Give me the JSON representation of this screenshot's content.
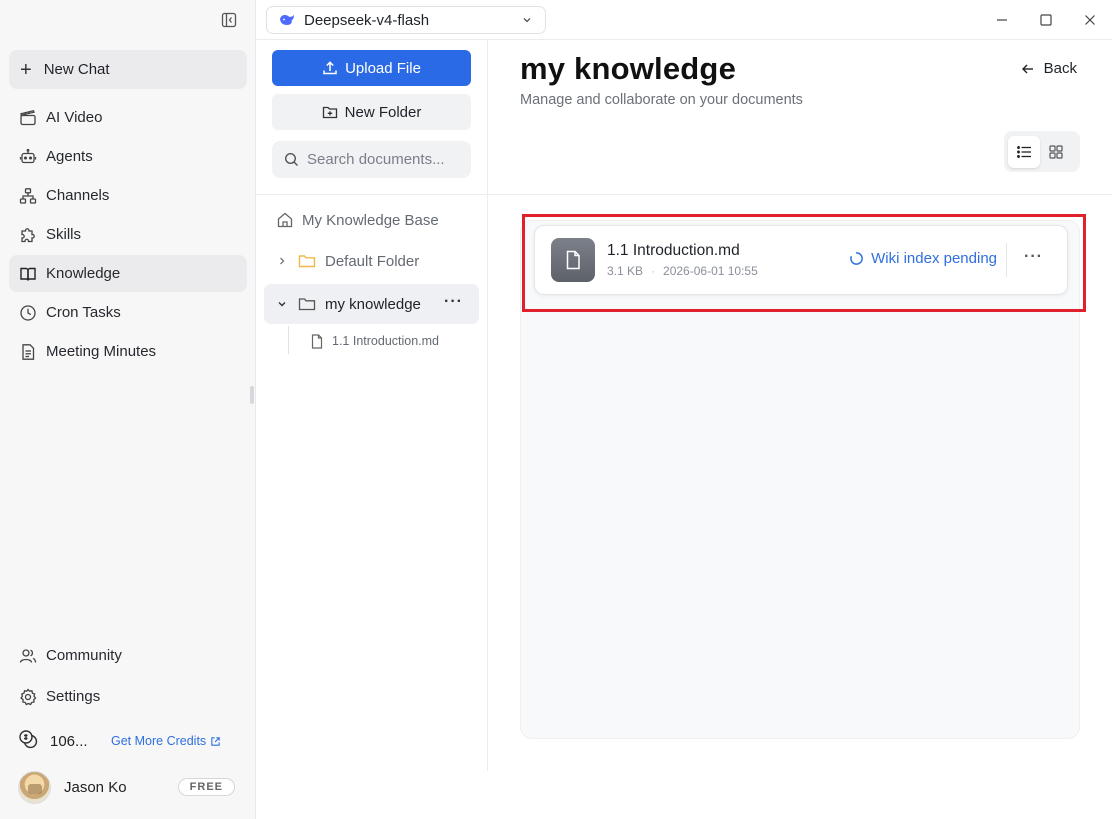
{
  "sidebar": {
    "new_chat": "New Chat",
    "items": [
      {
        "label": "AI Video",
        "icon": "clapperboard-icon"
      },
      {
        "label": "Agents",
        "icon": "robot-icon"
      },
      {
        "label": "Channels",
        "icon": "network-icon"
      },
      {
        "label": "Skills",
        "icon": "puzzle-icon"
      },
      {
        "label": "Knowledge",
        "icon": "book-icon",
        "active": true
      },
      {
        "label": "Cron Tasks",
        "icon": "clock-icon"
      },
      {
        "label": "Meeting Minutes",
        "icon": "document-icon"
      }
    ],
    "bottom_items": [
      {
        "label": "Community",
        "icon": "users-icon"
      },
      {
        "label": "Settings",
        "icon": "gear-icon"
      }
    ],
    "credits": "106...",
    "get_more_credits": "Get More Credits",
    "user_name": "Jason Ko",
    "plan_badge": "FREE"
  },
  "topbar": {
    "model": "Deepseek-v4-flash"
  },
  "tree_panel": {
    "upload_label": "Upload File",
    "new_folder_label": "New Folder",
    "search_placeholder": "Search documents...",
    "root_label": "My Knowledge Base",
    "folders": [
      {
        "label": "Default Folder",
        "expanded": false,
        "color": "#f5c04a"
      },
      {
        "label": "my knowledge",
        "expanded": true,
        "selected": true
      }
    ],
    "files": [
      "1.1 Introduction.md"
    ]
  },
  "main": {
    "title": "my knowledge",
    "subtitle": "Manage and collaborate on your documents",
    "back_label": "Back",
    "view_mode": "list",
    "document": {
      "name": "1.1 Introduction.md",
      "size": "3.1 KB",
      "date": "2026-06-01 10:55",
      "status": "Wiki index pending"
    }
  },
  "colors": {
    "accent": "#2b6ae6",
    "status": "#2f6fde",
    "highlight": "#e0202a"
  }
}
